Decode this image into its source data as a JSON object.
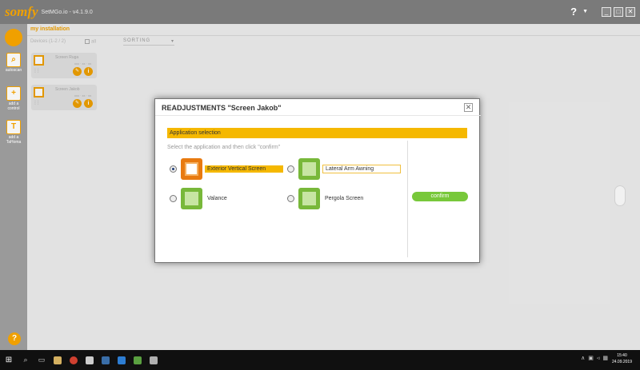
{
  "app": {
    "logo": "somfy",
    "subtitle": "SetMGo.io - v4.1.9.0",
    "help": "?",
    "window_buttons": [
      "_",
      "□",
      "✕"
    ]
  },
  "sidebar": {
    "items": [
      {
        "icon": "search-icon",
        "label": "autoscan"
      },
      {
        "icon": "add-control-icon",
        "label": "add a control"
      },
      {
        "icon": "tahoma-icon",
        "label": "add a TaHoma"
      }
    ],
    "help": "?"
  },
  "installation": {
    "title": "my installation",
    "devices_label": "Devices (1-2 / 2)",
    "all_label": "all",
    "sorting_label": "SORTING",
    "devices": [
      {
        "name": "Screen Ruga",
        "ids": "xxx · xx · xx"
      },
      {
        "name": "Screen Jakob",
        "ids": "xxx · xx · xx"
      }
    ]
  },
  "dialog": {
    "title": "READJUSTMENTS \"Screen Jakob\"",
    "section": "Application selection",
    "instruction": "Select the application and then click \"confirm\"",
    "options": [
      {
        "label": "Exterior Vertical Screen",
        "selected": true
      },
      {
        "label": "Lateral Arm Awning",
        "selected": false
      },
      {
        "label": "Valance",
        "selected": false
      },
      {
        "label": "Pergola Screen",
        "selected": false
      }
    ],
    "confirm": "confirm"
  },
  "taskbar": {
    "time": "15:40",
    "date": "24.09.2019"
  },
  "colors": {
    "brand": "#f0a000",
    "selection_bar": "#f5b800",
    "confirm": "#78c83a",
    "titlebar": "#7a7a7a"
  }
}
